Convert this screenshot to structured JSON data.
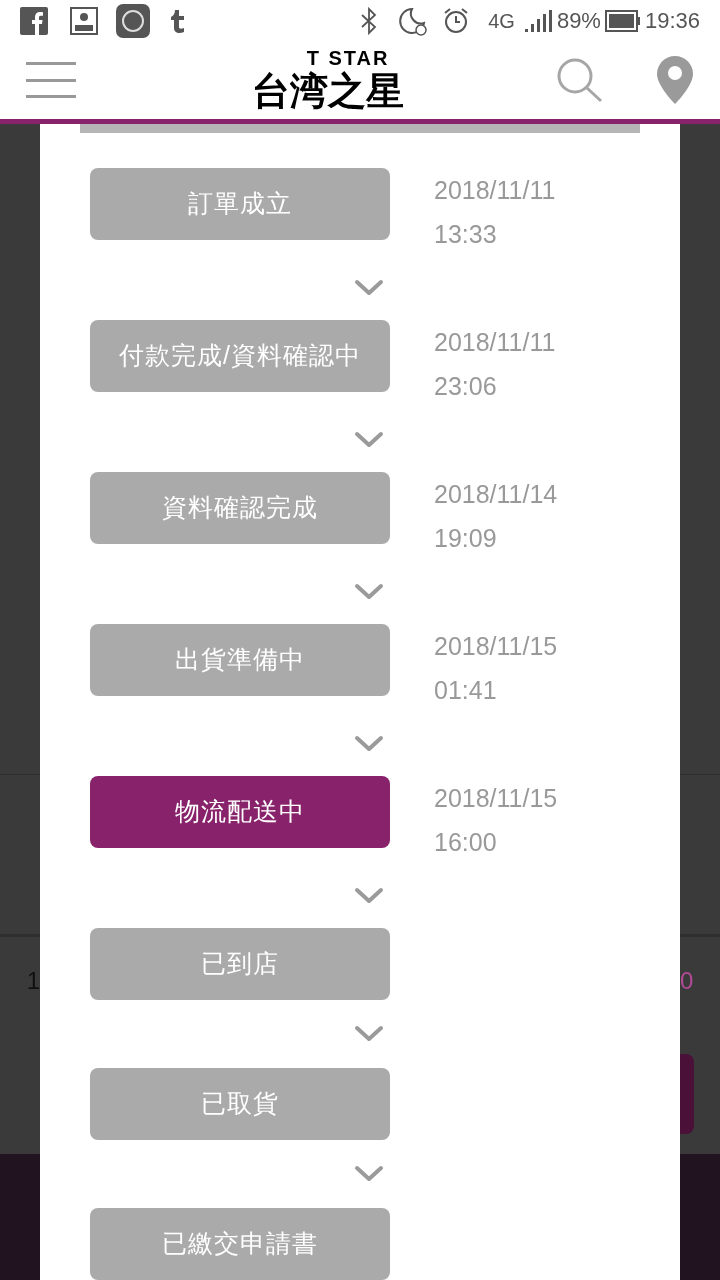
{
  "status_bar": {
    "battery": "89%",
    "time": "19:36",
    "network": "4G"
  },
  "header": {
    "logo_top": "T STAR",
    "logo_main": "台湾之星"
  },
  "background": {
    "row_text": "1",
    "price_text": "0"
  },
  "steps": [
    {
      "label": "訂單成立",
      "date": "2018/11/11",
      "time": "13:33",
      "selected": false
    },
    {
      "label": "付款完成/資料確認中",
      "date": "2018/11/11",
      "time": "23:06",
      "selected": false
    },
    {
      "label": "資料確認完成",
      "date": "2018/11/14",
      "time": "19:09",
      "selected": false
    },
    {
      "label": "出貨準備中",
      "date": "2018/11/15",
      "time": "01:41",
      "selected": false
    },
    {
      "label": "物流配送中",
      "date": "2018/11/15",
      "time": "16:00",
      "selected": true
    },
    {
      "label": "已到店",
      "selected": false
    },
    {
      "label": "已取貨",
      "selected": false
    },
    {
      "label": "已繳交申請書",
      "selected": false
    }
  ]
}
